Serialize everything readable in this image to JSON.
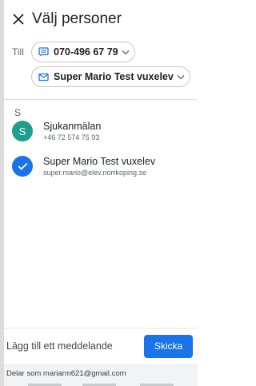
{
  "header": {
    "title": "Välj personer",
    "close_icon": "close-icon"
  },
  "recipients": {
    "to_label": "Till",
    "chips": [
      {
        "text": "070-496 67 79",
        "icon": "message-icon",
        "trailing_icon": "chevron-down-icon"
      },
      {
        "text": "Super Mario Test vuxelev",
        "icon": "email-icon",
        "trailing_icon": "chevron-down-icon"
      }
    ]
  },
  "contacts": {
    "section_letter": "S",
    "items": [
      {
        "avatar": "S",
        "name": "Sjukanmälan",
        "sub": "+46 72 574 75 93",
        "selected": false
      },
      {
        "avatar": "check-icon",
        "name": "Super Mario Test vuxelev",
        "sub": "super.mario@elev.norrkoping.se",
        "selected": true
      }
    ]
  },
  "compose": {
    "placeholder": "Lägg till ett meddelande",
    "send_label": "Skicka"
  },
  "footer": {
    "shared_as": "Delar som mariarm621@gmail.com"
  },
  "colors": {
    "accent": "#1a73e8",
    "avatar_teal": "#1e9e8c"
  }
}
